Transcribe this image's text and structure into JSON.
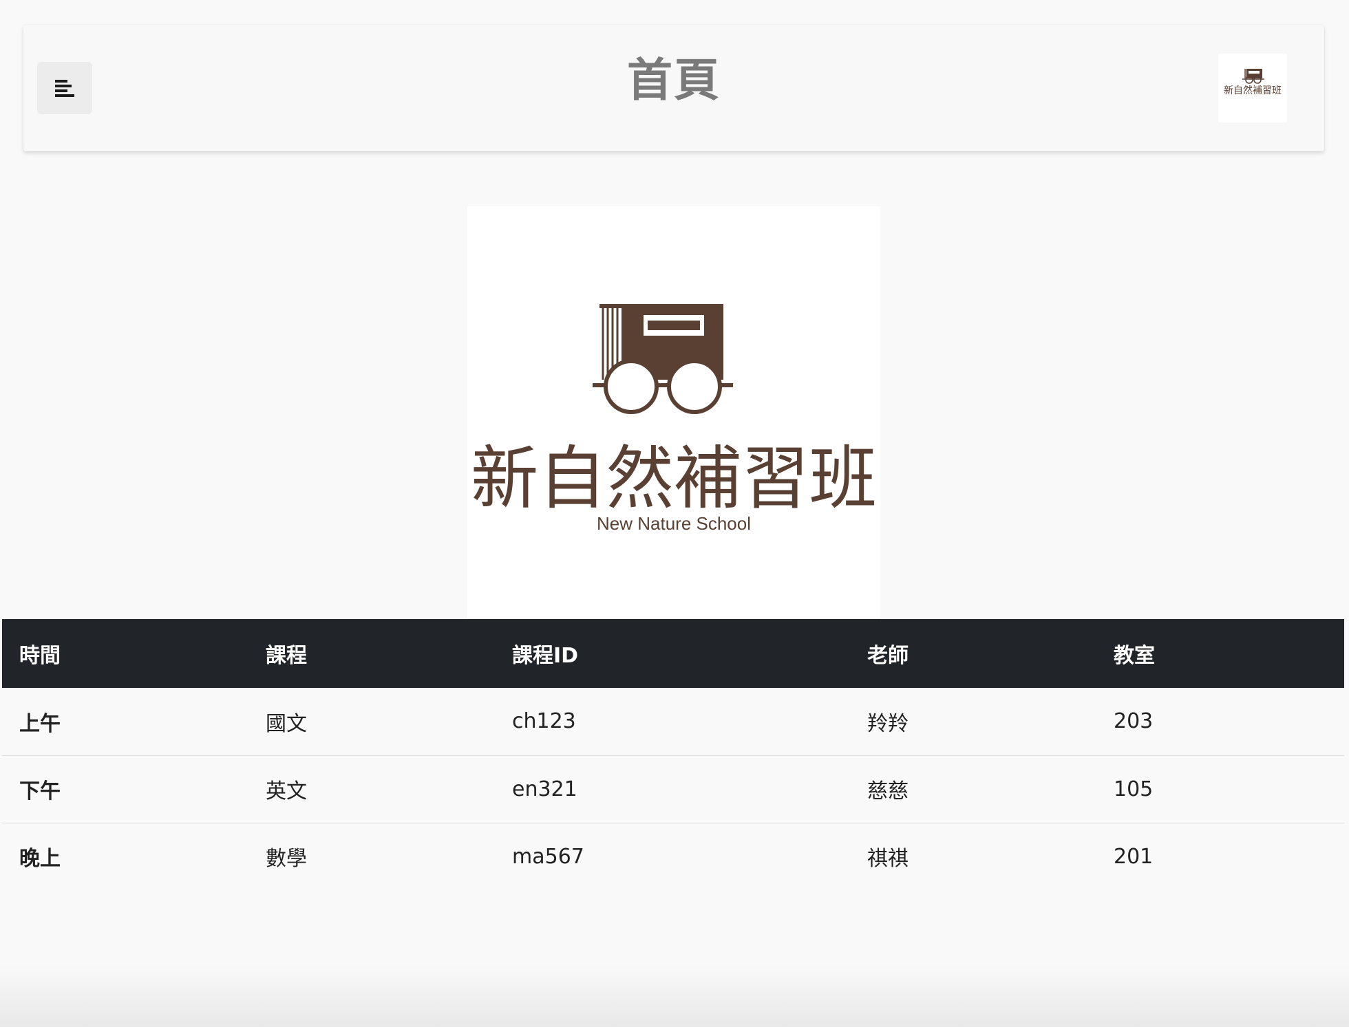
{
  "header": {
    "title": "首頁",
    "menu_icon": "menu-icon"
  },
  "logo": {
    "name_zh": "新自然補習班",
    "name_en": "New Nature School",
    "brand_color": "#5a4032"
  },
  "table": {
    "headers": [
      "時間",
      "課程",
      "課程ID",
      "老師",
      "教室"
    ],
    "rows": [
      [
        "上午",
        "國文",
        "ch123",
        "羚羚",
        "203"
      ],
      [
        "下午",
        "英文",
        "en321",
        "慈慈",
        "105"
      ],
      [
        "晚上",
        "數學",
        "ma567",
        "祺祺",
        "201"
      ]
    ]
  }
}
